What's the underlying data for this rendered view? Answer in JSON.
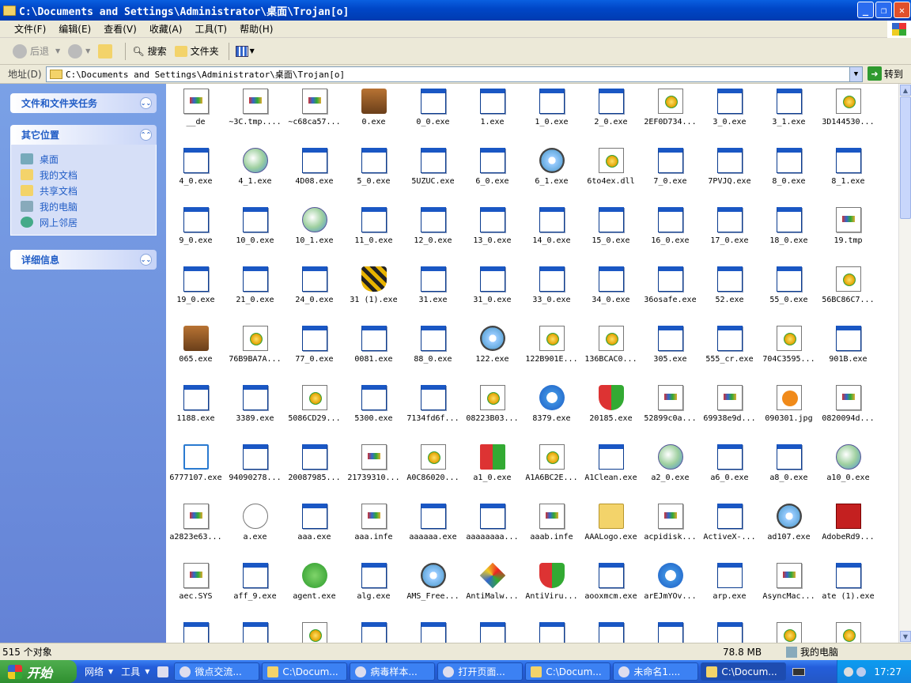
{
  "window": {
    "title": "C:\\Documents and Settings\\Administrator\\桌面\\Trojan[o]"
  },
  "menu": [
    "文件(F)",
    "编辑(E)",
    "查看(V)",
    "收藏(A)",
    "工具(T)",
    "帮助(H)"
  ],
  "toolbar": {
    "back": "后退",
    "search": "搜索",
    "folders": "文件夹"
  },
  "address": {
    "label": "地址(D)",
    "path": "C:\\Documents and Settings\\Administrator\\桌面\\Trojan[o]",
    "go": "转到"
  },
  "sidebar": {
    "tasks_title": "文件和文件夹任务",
    "places_title": "其它位置",
    "places": [
      "桌面",
      "我的文档",
      "共享文档",
      "我的电脑",
      "网上邻居"
    ],
    "details_title": "详细信息"
  },
  "files": [
    {
      "name": "__de",
      "icon": "doc"
    },
    {
      "name": "~3C.tmp....",
      "icon": "doc"
    },
    {
      "name": "~c68ca57...",
      "icon": "doc"
    },
    {
      "name": "0.exe",
      "icon": "tools"
    },
    {
      "name": "0_0.exe",
      "icon": "window"
    },
    {
      "name": "1.exe",
      "icon": "window"
    },
    {
      "name": "1_0.exe",
      "icon": "window"
    },
    {
      "name": "2_0.exe",
      "icon": "window"
    },
    {
      "name": "2EF0D734...",
      "icon": "gear"
    },
    {
      "name": "3_0.exe",
      "icon": "window"
    },
    {
      "name": "3_1.exe",
      "icon": "window"
    },
    {
      "name": "3D144530...",
      "icon": "gear"
    },
    {
      "name": "4_0.exe",
      "icon": "window"
    },
    {
      "name": "4_1.exe",
      "icon": "globe"
    },
    {
      "name": "4D08.exe",
      "icon": "window"
    },
    {
      "name": "5_0.exe",
      "icon": "window"
    },
    {
      "name": "5UZUC.exe",
      "icon": "window"
    },
    {
      "name": "6_0.exe",
      "icon": "window"
    },
    {
      "name": "6_1.exe",
      "icon": "cd"
    },
    {
      "name": "6to4ex.dll",
      "icon": "gear"
    },
    {
      "name": "7_0.exe",
      "icon": "window"
    },
    {
      "name": "7PVJQ.exe",
      "icon": "window"
    },
    {
      "name": "8_0.exe",
      "icon": "window"
    },
    {
      "name": "8_1.exe",
      "icon": "window"
    },
    {
      "name": "9_0.exe",
      "icon": "window"
    },
    {
      "name": "10_0.exe",
      "icon": "window"
    },
    {
      "name": "10_1.exe",
      "icon": "globe"
    },
    {
      "name": "11_0.exe",
      "icon": "window"
    },
    {
      "name": "12_0.exe",
      "icon": "window"
    },
    {
      "name": "13_0.exe",
      "icon": "window"
    },
    {
      "name": "14_0.exe",
      "icon": "window"
    },
    {
      "name": "15_0.exe",
      "icon": "window"
    },
    {
      "name": "16_0.exe",
      "icon": "window"
    },
    {
      "name": "17_0.exe",
      "icon": "window"
    },
    {
      "name": "18_0.exe",
      "icon": "window"
    },
    {
      "name": "19.tmp",
      "icon": "doc"
    },
    {
      "name": "19_0.exe",
      "icon": "window"
    },
    {
      "name": "21_0.exe",
      "icon": "window"
    },
    {
      "name": "24_0.exe",
      "icon": "window"
    },
    {
      "name": "31 (1).exe",
      "icon": "stripe"
    },
    {
      "name": "31.exe",
      "icon": "window"
    },
    {
      "name": "31_0.exe",
      "icon": "window"
    },
    {
      "name": "33_0.exe",
      "icon": "window"
    },
    {
      "name": "34_0.exe",
      "icon": "window"
    },
    {
      "name": "36osafe.exe",
      "icon": "window"
    },
    {
      "name": "52.exe",
      "icon": "window"
    },
    {
      "name": "55_0.exe",
      "icon": "window"
    },
    {
      "name": "56BC86C7...",
      "icon": "gear"
    },
    {
      "name": "065.exe",
      "icon": "tools"
    },
    {
      "name": "76B9BA7A...",
      "icon": "gear"
    },
    {
      "name": "77_0.exe",
      "icon": "window"
    },
    {
      "name": "0081.exe",
      "icon": "window"
    },
    {
      "name": "88_0.exe",
      "icon": "window"
    },
    {
      "name": "122.exe",
      "icon": "cd"
    },
    {
      "name": "122B901E...",
      "icon": "gear"
    },
    {
      "name": "136BCAC0...",
      "icon": "gear"
    },
    {
      "name": "305.exe",
      "icon": "window"
    },
    {
      "name": "555_cr.exe",
      "icon": "window"
    },
    {
      "name": "704C3595...",
      "icon": "gear"
    },
    {
      "name": "901B.exe",
      "icon": "window"
    },
    {
      "name": "1188.exe",
      "icon": "window"
    },
    {
      "name": "3389.exe",
      "icon": "window"
    },
    {
      "name": "5086CD29...",
      "icon": "gear"
    },
    {
      "name": "5300.exe",
      "icon": "window"
    },
    {
      "name": "7134fd6f...",
      "icon": "window"
    },
    {
      "name": "08223B03...",
      "icon": "gear"
    },
    {
      "name": "8379.exe",
      "icon": "ie"
    },
    {
      "name": "20185.exe",
      "icon": "shield"
    },
    {
      "name": "52899c0a...",
      "icon": "doc"
    },
    {
      "name": "69938e9d...",
      "icon": "doc"
    },
    {
      "name": "090301.jpg",
      "icon": "jpg"
    },
    {
      "name": "0820094d...",
      "icon": "doc"
    },
    {
      "name": "6777107.exe",
      "icon": "home"
    },
    {
      "name": "94090278...",
      "icon": "window"
    },
    {
      "name": "20087985...",
      "icon": "window"
    },
    {
      "name": "21739310...",
      "icon": "doc"
    },
    {
      "name": "A0C86020...",
      "icon": "gear"
    },
    {
      "name": "a1_0.exe",
      "icon": "win"
    },
    {
      "name": "A1A6BC2E...",
      "icon": "gear"
    },
    {
      "name": "A1Clean.exe",
      "icon": "list"
    },
    {
      "name": "a2_0.exe",
      "icon": "globe"
    },
    {
      "name": "a6_0.exe",
      "icon": "window"
    },
    {
      "name": "a8_0.exe",
      "icon": "window"
    },
    {
      "name": "a10_0.exe",
      "icon": "globe"
    },
    {
      "name": "a2823e63...",
      "icon": "doc"
    },
    {
      "name": "a.exe",
      "icon": "key"
    },
    {
      "name": "aaa.exe",
      "icon": "window"
    },
    {
      "name": "aaa.infe",
      "icon": "doc"
    },
    {
      "name": "aaaaaa.exe",
      "icon": "window"
    },
    {
      "name": "aaaaaaaa...",
      "icon": "window"
    },
    {
      "name": "aaab.infe",
      "icon": "doc"
    },
    {
      "name": "AAALogo.exe",
      "icon": "folder"
    },
    {
      "name": "acpidisk...",
      "icon": "doc"
    },
    {
      "name": "ActiveX-...",
      "icon": "window"
    },
    {
      "name": "ad107.exe",
      "icon": "cd"
    },
    {
      "name": "AdobeRd9...",
      "icon": "red"
    },
    {
      "name": "aec.SYS",
      "icon": "doc"
    },
    {
      "name": "aff_9.exe",
      "icon": "window"
    },
    {
      "name": "agent.exe",
      "icon": "check"
    },
    {
      "name": "alg.exe",
      "icon": "window"
    },
    {
      "name": "AMS_Free...",
      "icon": "cd"
    },
    {
      "name": "AntiMalw...",
      "icon": "diamond"
    },
    {
      "name": "AntiViru...",
      "icon": "shield"
    },
    {
      "name": "aooxmcm.exe",
      "icon": "window"
    },
    {
      "name": "arEJmYOv...",
      "icon": "ie"
    },
    {
      "name": "arp.exe",
      "icon": "list"
    },
    {
      "name": "AsyncMac...",
      "icon": "doc"
    },
    {
      "name": "ate (1).exe",
      "icon": "window"
    },
    {
      "name": "",
      "icon": "window"
    },
    {
      "name": "",
      "icon": "window"
    },
    {
      "name": "",
      "icon": "gear"
    },
    {
      "name": "",
      "icon": "window"
    },
    {
      "name": "",
      "icon": "window"
    },
    {
      "name": "",
      "icon": "window"
    },
    {
      "name": "",
      "icon": "window"
    },
    {
      "name": "",
      "icon": "window"
    },
    {
      "name": "",
      "icon": "window"
    },
    {
      "name": "",
      "icon": "window"
    },
    {
      "name": "",
      "icon": "gear"
    },
    {
      "name": "",
      "icon": "gear"
    }
  ],
  "status": {
    "count": "515 个对象",
    "size": "78.8 MB",
    "location": "我的电脑"
  },
  "taskbar": {
    "start": "开始",
    "quick": [
      "网络",
      "工具"
    ],
    "tasks": [
      "微点交流...",
      "C:\\Docum...",
      "病毒样本...",
      "打开页面...",
      "C:\\Docum...",
      "未命名1....",
      "C:\\Docum..."
    ],
    "clock": "17:27"
  }
}
